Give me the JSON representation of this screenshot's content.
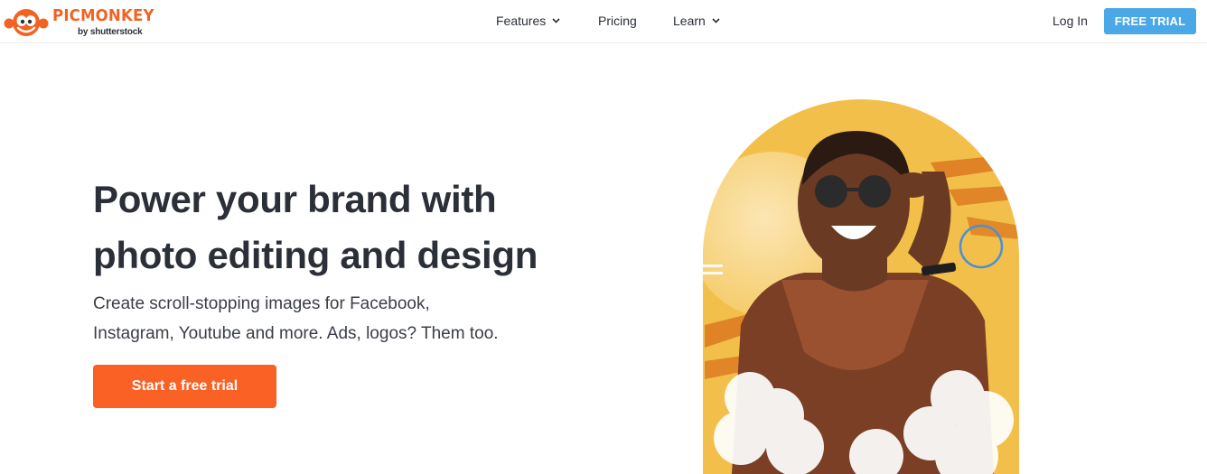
{
  "header": {
    "logo": {
      "wordmark": "PICMONKEY",
      "byline": "by shutterstock"
    },
    "nav": [
      {
        "label": "Features",
        "has_dropdown": true
      },
      {
        "label": "Pricing",
        "has_dropdown": false
      },
      {
        "label": "Learn",
        "has_dropdown": true
      }
    ],
    "login_label": "Log In",
    "trial_label": "FREE TRIAL"
  },
  "hero": {
    "title_line1": "Power your brand with",
    "title_line2": "photo editing and design",
    "subtitle_line1": "Create scroll-stopping images for Facebook,",
    "subtitle_line2": "Instagram, Youtube and more. Ads, logos? Them too.",
    "cta_label": "Start a free trial"
  },
  "colors": {
    "brand_orange": "#f26322",
    "cta_orange": "#f96125",
    "trial_blue": "#4ba8e6",
    "text_dark": "#2b2f38",
    "arch_yellow": "#f2c04a"
  },
  "icons": [
    "monkey-logo-icon",
    "chevron-down-icon",
    "focus-circle-icon"
  ]
}
